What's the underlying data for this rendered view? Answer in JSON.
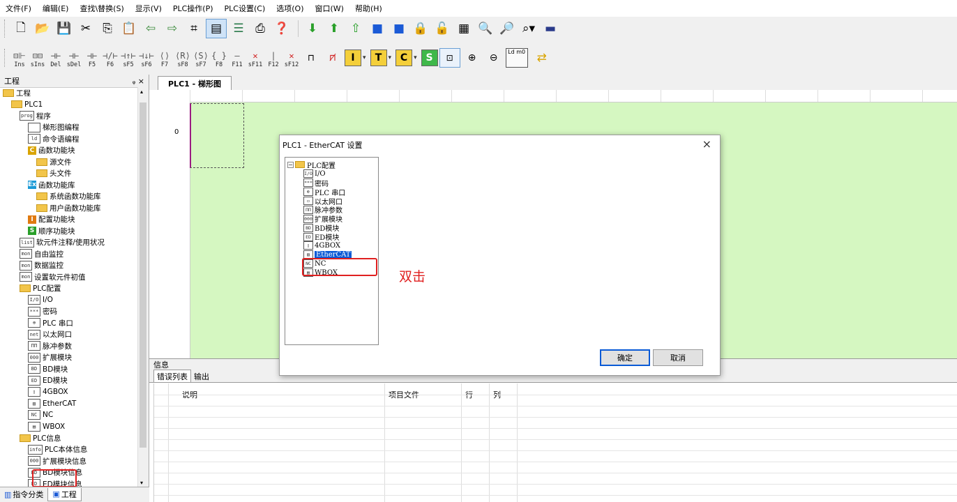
{
  "menu": [
    "文件(F)",
    "编辑(E)",
    "查找\\替换(S)",
    "显示(V)",
    "PLC操作(P)",
    "PLC设置(C)",
    "选项(O)",
    "窗口(W)",
    "帮助(H)"
  ],
  "toolbar_keys": [
    {
      "label": "Ins",
      "glyph": "⊟⊩"
    },
    {
      "label": "sIns",
      "glyph": "⊟⊟"
    },
    {
      "label": "Del",
      "glyph": "⊣⊢"
    },
    {
      "label": "sDel",
      "glyph": "⊣⊢"
    },
    {
      "label": "F5",
      "glyph": "⊣⊢"
    },
    {
      "label": "F6",
      "glyph": "⊣/⊢"
    },
    {
      "label": "sF5",
      "glyph": "⊣↑⊢"
    },
    {
      "label": "sF6",
      "glyph": "⊣↓⊢"
    },
    {
      "label": "F7",
      "glyph": "⟨⟩"
    },
    {
      "label": "sF8",
      "glyph": "⟨R⟩"
    },
    {
      "label": "sF7",
      "glyph": "⟨S⟩"
    },
    {
      "label": "F8",
      "glyph": "{ }"
    },
    {
      "label": "F11",
      "glyph": "—"
    },
    {
      "label": "sF11",
      "glyph": "✕"
    },
    {
      "label": "F12",
      "glyph": "|"
    },
    {
      "label": "sF12",
      "glyph": "✕"
    }
  ],
  "toolbar_letters": [
    "I",
    "T",
    "C",
    "S"
  ],
  "toolbar_ld_label": "Ld m0",
  "project_panel": {
    "title": "工程",
    "pin": "ᵩ ×",
    "tree": [
      {
        "label": "工程",
        "level": 0,
        "icon": "folder"
      },
      {
        "label": "PLC1",
        "level": 1,
        "icon": "folder"
      },
      {
        "label": "程序",
        "level": 2,
        "icon": "prog"
      },
      {
        "label": "梯形图编程",
        "level": 3,
        "icon": "ladder"
      },
      {
        "label": "命令语编程",
        "level": 3,
        "icon": "ld"
      },
      {
        "label": "函数功能块",
        "level": 3,
        "icon": "C"
      },
      {
        "label": "源文件",
        "level": 4,
        "icon": "folder"
      },
      {
        "label": "头文件",
        "level": 4,
        "icon": "folder"
      },
      {
        "label": "函数功能库",
        "level": 3,
        "icon": "Ex"
      },
      {
        "label": "系统函数功能库",
        "level": 4,
        "icon": "folder"
      },
      {
        "label": "用户函数功能库",
        "level": 4,
        "icon": "folder"
      },
      {
        "label": "配置功能块",
        "level": 3,
        "icon": "I"
      },
      {
        "label": "顺序功能块",
        "level": 3,
        "icon": "S"
      },
      {
        "label": "软元件注释/使用状况",
        "level": 2,
        "icon": "list"
      },
      {
        "label": "自由监控",
        "level": 2,
        "icon": "mon"
      },
      {
        "label": "数据监控",
        "level": 2,
        "icon": "mon"
      },
      {
        "label": "设置软元件初值",
        "level": 2,
        "icon": "mon"
      },
      {
        "label": "PLC配置",
        "level": 2,
        "icon": "folder"
      },
      {
        "label": "I/O",
        "level": 3,
        "icon": "I/O"
      },
      {
        "label": "密码",
        "level": 3,
        "icon": "***"
      },
      {
        "label": "PLC 串口",
        "level": 3,
        "icon": "⊕"
      },
      {
        "label": "以太网口",
        "level": 3,
        "icon": "net"
      },
      {
        "label": "脉冲参数",
        "level": 3,
        "icon": "ΠΠ"
      },
      {
        "label": "扩展模块",
        "level": 3,
        "icon": "000"
      },
      {
        "label": "BD模块",
        "level": 3,
        "icon": "BD"
      },
      {
        "label": "ED模块",
        "level": 3,
        "icon": "ED"
      },
      {
        "label": "4GBOX",
        "level": 3,
        "icon": "▯"
      },
      {
        "label": "EtherCAT",
        "level": 3,
        "icon": "▥"
      },
      {
        "label": "NC",
        "level": 3,
        "icon": "NC"
      },
      {
        "label": "WBOX",
        "level": 3,
        "icon": "▤"
      },
      {
        "label": "PLC信息",
        "level": 2,
        "icon": "folder"
      },
      {
        "label": "PLC本体信息",
        "level": 3,
        "icon": "info"
      },
      {
        "label": "扩展模块信息",
        "level": 3,
        "icon": "000"
      },
      {
        "label": "BD模块信息",
        "level": 3,
        "icon": "BD"
      },
      {
        "label": "ED模块信息",
        "level": 3,
        "icon": "ED"
      }
    ],
    "bottom_tabs": [
      "指令分类",
      "工程"
    ]
  },
  "ladder": {
    "tab": "PLC1 - 梯形图",
    "rung_number": "0"
  },
  "info_panel": {
    "title": "信息",
    "tabs": [
      "错误列表",
      "输出"
    ],
    "columns": [
      "说明",
      "项目文件",
      "行",
      "列"
    ]
  },
  "dialog": {
    "title": "PLC1 - EtherCAT  设置",
    "close": "×",
    "root": "PLC配置",
    "items": [
      {
        "icon": "I/O",
        "label": "I/O"
      },
      {
        "icon": "***",
        "label": "密码"
      },
      {
        "icon": "⊕",
        "label": "PLC 串口"
      },
      {
        "icon": "▭",
        "label": "以太网口"
      },
      {
        "icon": "ΠΠ",
        "label": "脉冲参数"
      },
      {
        "icon": "000",
        "label": "扩展模块"
      },
      {
        "icon": "BD",
        "label": "BD模块"
      },
      {
        "icon": "ED",
        "label": "ED模块"
      },
      {
        "icon": "▯",
        "label": "4GBOX"
      },
      {
        "icon": "▥",
        "label": "EtherCAT"
      },
      {
        "icon": "NC",
        "label": "NC"
      },
      {
        "icon": "▤",
        "label": "WBOX"
      }
    ],
    "annotation": "双击",
    "ok_label": "确定",
    "cancel_label": "取消"
  },
  "colors": {
    "ladder_bg": "#d5f7c1",
    "highlight": "#e02020",
    "selection": "#0a5ad6"
  }
}
